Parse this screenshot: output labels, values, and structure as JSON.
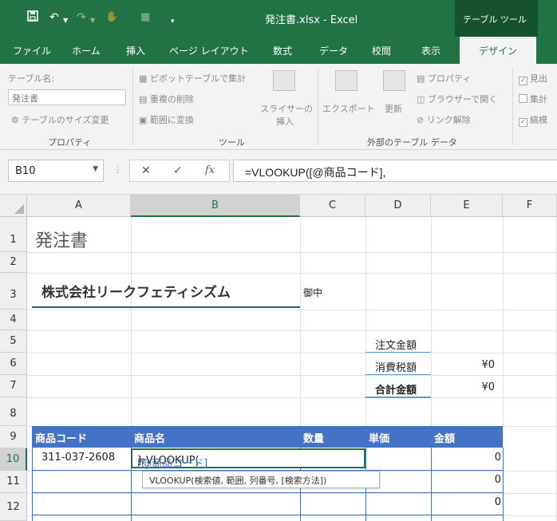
{
  "titlebar": {
    "title": "発注書.xlsx  -  Excel",
    "contextual_tab": "テーブル ツール"
  },
  "tabs": [
    "ファイル",
    "ホーム",
    "挿入",
    "ページ レイアウト",
    "数式",
    "データ",
    "校閲",
    "表示",
    "デザイン"
  ],
  "active_tab": "デザイン",
  "ribbon": {
    "table_name_label": "テーブル名:",
    "table_name_value": "発注書",
    "resize_table": "テーブルのサイズ変更",
    "properties_group": "プロパティ",
    "summarize_pivot": "ピボットテーブルで集計",
    "remove_duplicates": "重複の削除",
    "convert_to_range": "範囲に変換",
    "slicer_line1": "スライサーの",
    "slicer_line2": "挿入",
    "tools_group": "ツール",
    "export": "エクスポート",
    "refresh": "更新",
    "properties_btn": "プロパティ",
    "open_in_browser": "ブラウザーで開く",
    "unlink": "リンク解除",
    "external_group": "外部のテーブル データ",
    "opt1": "見出",
    "opt2": "集計",
    "opt3": "縞模"
  },
  "formula_bar": {
    "name_box": "B10",
    "formula": "=VLOOKUP([@商品コード],"
  },
  "columns": [
    "A",
    "B",
    "C",
    "D",
    "E",
    "F"
  ],
  "selected_column": "B",
  "rows": [
    "1",
    "2",
    "3",
    "4",
    "5",
    "6",
    "7",
    "8",
    "9",
    "10",
    "11",
    "12"
  ],
  "selected_row": "10",
  "sheet": {
    "doc_title": "発注書",
    "company": "株式会社リークフェティシズム",
    "honorific": "御中",
    "summary": [
      {
        "label": "注文金額",
        "value": ""
      },
      {
        "label": "消費税額",
        "value": "¥0"
      },
      {
        "label": "合計金額",
        "value": "¥0"
      }
    ],
    "table_headers": [
      "商品コード",
      "商品名",
      "数量",
      "単価",
      "金額"
    ],
    "row10": {
      "code": "311-037-2608",
      "formula_prefix": "=VLOOKUP(",
      "formula_ref": "[@商品コード]",
      "formula_suffix": "],",
      "amount": "0"
    },
    "row11_amount": "0",
    "row12_amount": "0",
    "tooltip": "VLOOKUP(検索値, 範囲, 列番号, [検索方法])"
  },
  "colors": {
    "excel_green": "#217346",
    "table_header": "#4472c4",
    "company_underline": "#2f5597"
  }
}
